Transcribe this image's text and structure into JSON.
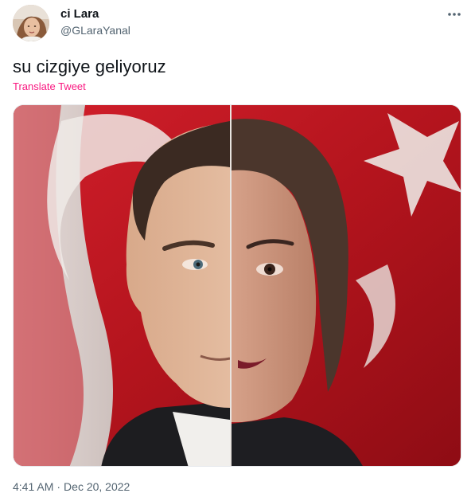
{
  "author": {
    "display_name": "ci Lara",
    "handle": "@GLaraYanal",
    "avatar_icon": "profile-photo"
  },
  "more_icon": "more-horizontal-icon",
  "tweet": {
    "text": "su cizgiye geliyoruz",
    "translate_label": "Translate Tweet"
  },
  "media": {
    "type": "photo"
  },
  "meta": {
    "time": "4:41 AM",
    "separator": "·",
    "date": "Dec 20, 2022"
  },
  "colors": {
    "text_primary": "#0f1419",
    "text_secondary": "#536471",
    "translate_link": "#f91880",
    "flag_red": "#c8102e"
  }
}
